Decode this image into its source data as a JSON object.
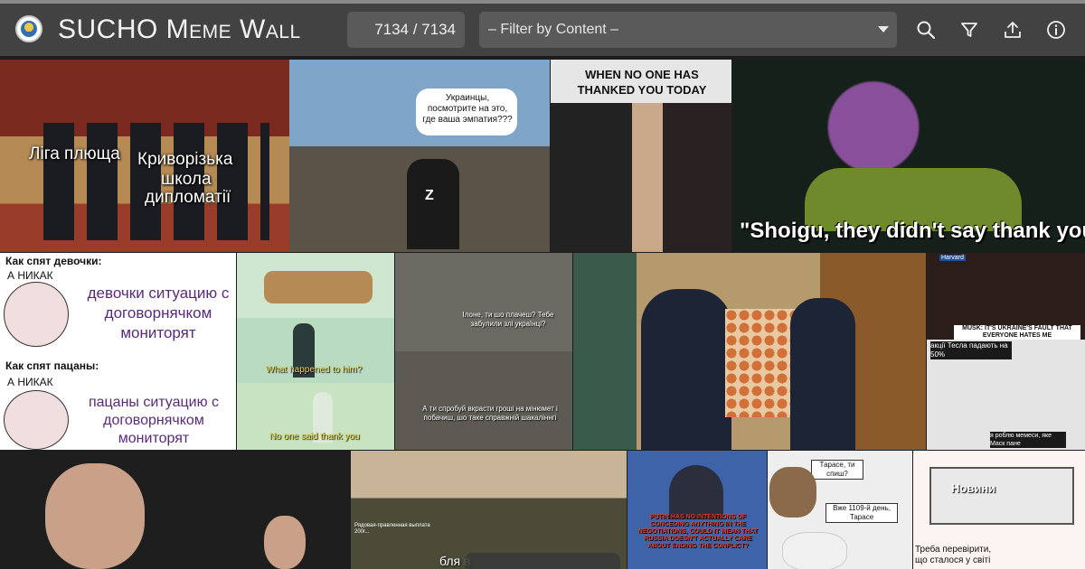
{
  "header": {
    "title": "SUCHO Meme Wall",
    "counter": "7134 / 7134",
    "filter_placeholder": "– Filter by Content –"
  },
  "icons": [
    "logo-seal",
    "search-icon",
    "filter-icon",
    "upload-icon",
    "info-icon",
    "chevron-down-icon"
  ],
  "colors": {
    "header_bg": "#424242",
    "field_bg": "#5a5a5a",
    "grid_bg": "#1d1d1d"
  },
  "memes": {
    "m1": {
      "line1": "Ліга плюща",
      "line2": "Криворізька",
      "line3": "школа",
      "line4": "дипломатії"
    },
    "m2": {
      "bubble": "Украинцы, посмотрите на это, где ваша эмпатия???",
      "shirt": "Z"
    },
    "m3": {
      "caption": "WHEN NO ONE HAS THANKED YOU TODAY"
    },
    "m4": {
      "caption": "\"Shoigu, they didn't say thank you\""
    },
    "m5": {
      "l1": "Как спят девочки:",
      "l2": "А НИКАК",
      "l3": "девочки ситуацию с договорнячком мониторят",
      "l4": "Как спят пацаны:",
      "l5": "А НИКАК",
      "l6": "пацаны ситуацию с договорнячком мониторят"
    },
    "m6": {
      "q": "What happened to him?",
      "a": "No one said thank you"
    },
    "m7": {
      "top": "Ілоне, ти шо плачеш? Тебе забулили злі українці?",
      "bottom": "А ти спробуй вкрасти гроші на мінюмет і побачиш, шо таке справжній шакаліннгі"
    },
    "m9": {
      "banner": "MUSK: IT'S UKRAINE'S FAULT THAT EVERYONE HATES ME",
      "tag": "Harvard",
      "l1": "акції Тесла падають на 50%",
      "l2": "я роблю мемеси, яке Маск пане"
    },
    "m11": {
      "caption": "бля в"
    },
    "m12": {
      "caption": "PUTIN HAS NO INTENTIONS OF CONCEDING ANYTHING IN THE NEGOTIATIONS, COULD IT MEAN THAT RUSSIA DOESN'T ACTUALLY CARE ABOUT ENDING THE CONFLICT?"
    },
    "m13": {
      "q": "Тарасе, ти спиш?",
      "a": "Вже 1109-й день, Тарасе"
    },
    "m14": {
      "label": "Новини",
      "caption": "Треба перевірити, що сталося у світі"
    },
    "m10": {
      "caption": "Рядовая-правленная выплата 200г... "
    }
  }
}
